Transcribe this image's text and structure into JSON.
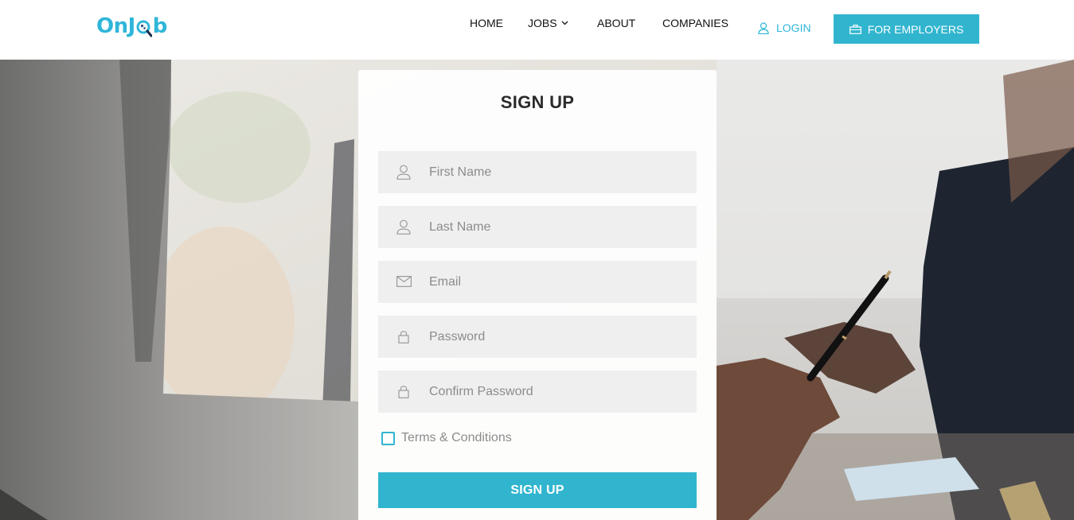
{
  "brand": {
    "logo_text_left": "OnJ",
    "logo_text_right": "b"
  },
  "nav": {
    "home": "HOME",
    "jobs": "JOBS",
    "about": "ABOUT",
    "companies": "COMPANIES",
    "login": "LOGIN",
    "employers": "FOR EMPLOYERS"
  },
  "form": {
    "title": "SIGN UP",
    "fields": [
      {
        "placeholder": "First Name",
        "icon": "user-icon"
      },
      {
        "placeholder": "Last Name",
        "icon": "user-icon"
      },
      {
        "placeholder": "Email",
        "icon": "envelope-icon"
      },
      {
        "placeholder": "Password",
        "icon": "lock-icon"
      },
      {
        "placeholder": "Confirm Password",
        "icon": "lock-icon"
      }
    ],
    "terms_label": "Terms & Conditions",
    "submit_label": "SIGN UP"
  },
  "colors": {
    "accent": "#31b5cf",
    "field_bg": "#f0efef"
  }
}
